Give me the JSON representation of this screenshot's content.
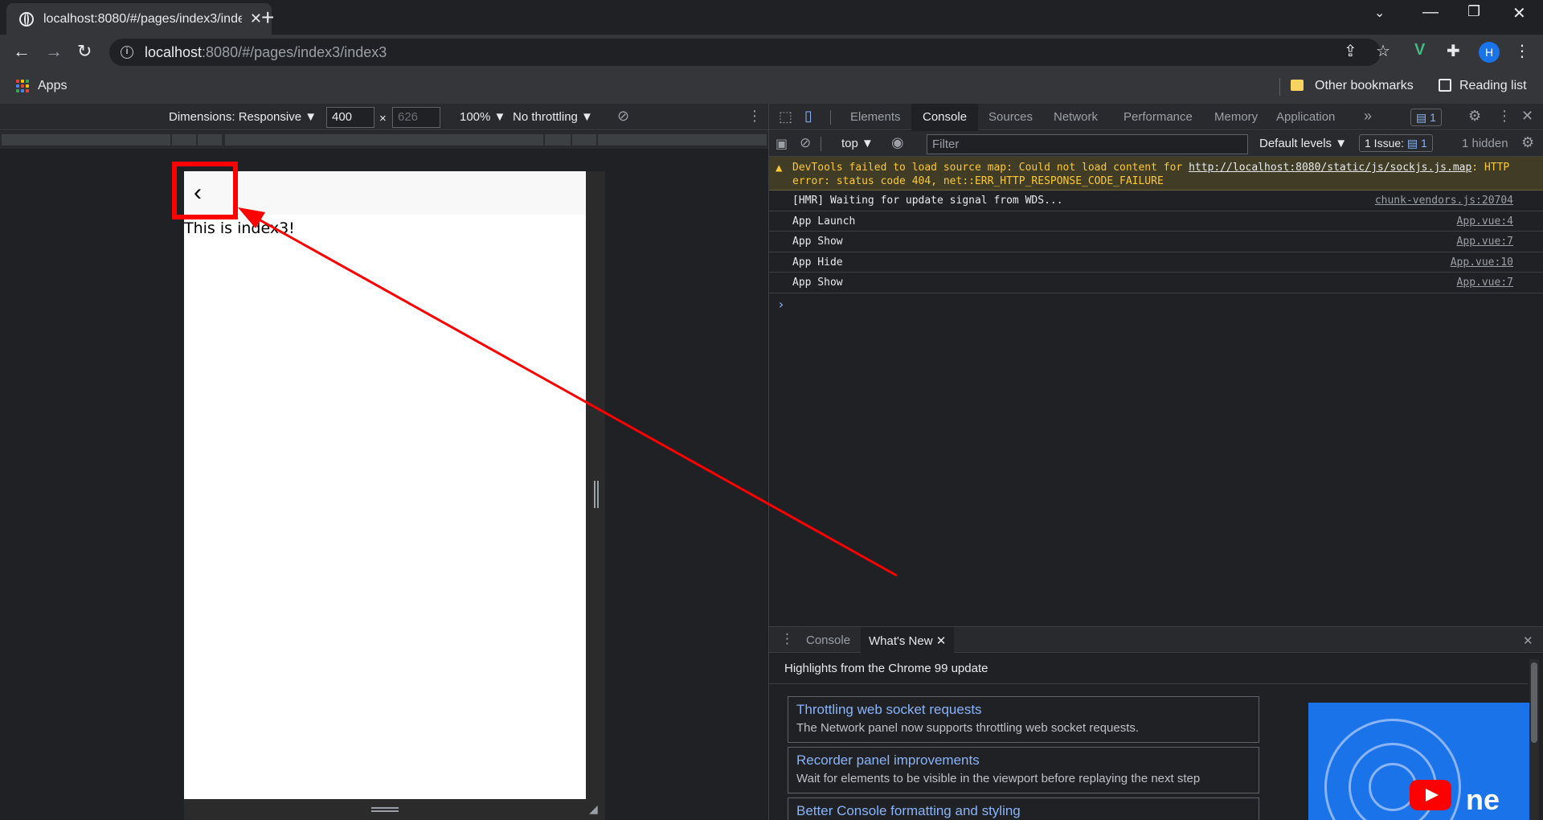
{
  "browser": {
    "tab_title": "localhost:8080/#/pages/index3/index3",
    "url_host": "localhost",
    "url_rest": ":8080/#/pages/index3/index3",
    "avatar_initial": "H"
  },
  "bookmarks": {
    "apps_label": "Apps",
    "other_label": "Other bookmarks",
    "reading_label": "Reading list"
  },
  "device_toolbar": {
    "dimensions_label": "Dimensions: Responsive ▼",
    "width_value": "400",
    "times": "×",
    "height_value": "626",
    "zoom": "100% ▼",
    "throttle": "No throttling ▼"
  },
  "viewport": {
    "back_glyph": "‹",
    "body_text": "This is index3!"
  },
  "devtools": {
    "tabs": [
      "Elements",
      "Console",
      "Sources",
      "Network",
      "Performance",
      "Memory",
      "Application"
    ],
    "active_tab": "Console",
    "more": "»",
    "msg_badge": "1",
    "context": "top ▼",
    "filter_placeholder": "Filter",
    "levels": "Default levels ▼",
    "issues": "1 Issue:",
    "issues_count": "1",
    "hidden": "1 hidden",
    "warning_text": "DevTools failed to load source map: Could not load content for ",
    "warning_link": "http://localhost:8080/static/js/sockjs.js.map",
    "warning_text2": ": HTTP error: status code 404, net::ERR_HTTP_RESPONSE_CODE_FAILURE",
    "messages": [
      {
        "text": "[HMR] Waiting for update signal from WDS...",
        "src": "chunk-vendors.js:20704"
      },
      {
        "text": "App Launch",
        "src": "App.vue:4"
      },
      {
        "text": "App Show",
        "src": "App.vue:7"
      },
      {
        "text": "App Hide",
        "src": "App.vue:10"
      },
      {
        "text": "App Show",
        "src": "App.vue:7"
      }
    ],
    "prompt": "›"
  },
  "drawer": {
    "tab_console": "Console",
    "tab_whats_new": "What's New",
    "heading": "Highlights from the Chrome 99 update",
    "cards": [
      {
        "title": "Throttling web socket requests",
        "desc": "The Network panel now supports throttling web socket requests."
      },
      {
        "title": "Recorder panel improvements",
        "desc": "Wait for elements to be visible in the viewport before replaying the next step"
      },
      {
        "title": "Better Console formatting and styling",
        "desc": ""
      }
    ]
  },
  "colors": {
    "annotation": "#ff0000",
    "accent": "#8ab4f8"
  }
}
